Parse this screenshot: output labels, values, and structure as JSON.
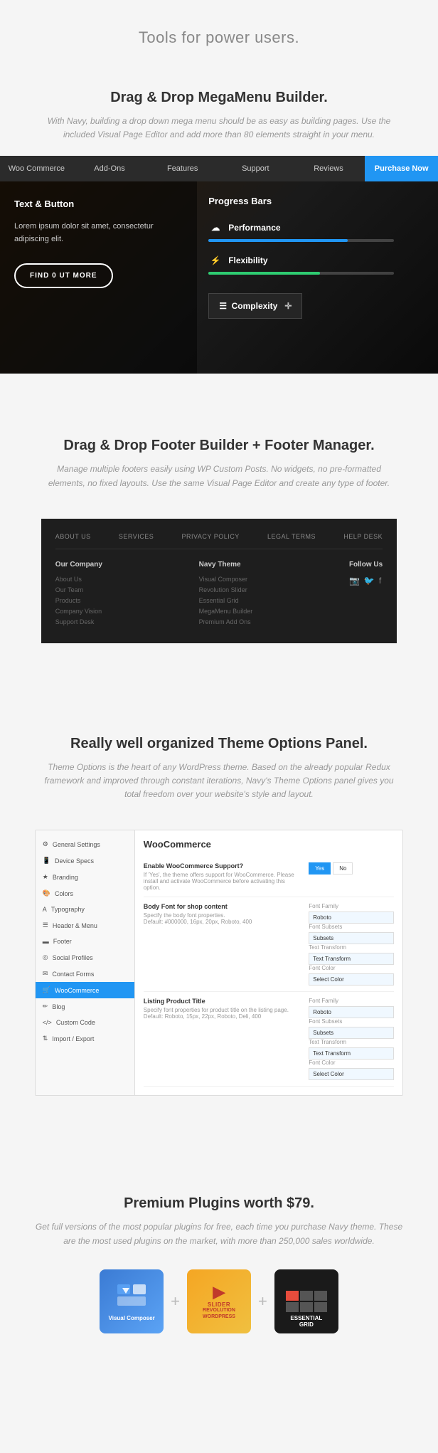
{
  "hero": {
    "title": "Tools for power users."
  },
  "megamenu": {
    "heading": "Drag & Drop MegaMenu Builder.",
    "description": "With Navy, building a drop down mega menu should be as easy as building pages. Use the included Visual Page Editor and add more than 80 elements straight in your menu."
  },
  "navbar": {
    "items": [
      {
        "label": "Woo Commerce",
        "active": false
      },
      {
        "label": "Add-Ons",
        "active": false
      },
      {
        "label": "Features",
        "active": false
      },
      {
        "label": "Support",
        "active": false
      },
      {
        "label": "Reviews",
        "active": false
      },
      {
        "label": "Purchase Now",
        "active": true
      }
    ]
  },
  "demo": {
    "left_heading": "Text & Button",
    "left_body": "Lorem ipsum dolor sit amet, consectetur adipiscing elit.",
    "find_out_more": "FIND 0 UT MoRE",
    "right_heading": "Progress Bars",
    "progress_items": [
      {
        "label": "Performance",
        "fill": 75,
        "icon": "☁"
      },
      {
        "label": "Flexibility",
        "fill": 60,
        "icon": "⚡"
      }
    ],
    "complexity_label": "Complexity"
  },
  "footer_builder": {
    "heading": "Drag & Drop Footer Builder + Footer Manager.",
    "description": "Manage multiple footers easily using WP Custom Posts. No widgets, no pre-formatted elements, no fixed layouts. Use the same Visual Page Editor and create any type of footer.",
    "footer_nav": [
      "ABOUT US",
      "SERVICES",
      "PRIVACY POLICY",
      "LEGAL TERMS",
      "HELP DESK"
    ],
    "footer_cols": [
      {
        "heading": "Our Company",
        "links": [
          "About Us",
          "Our Team",
          "Products",
          "Company Vision",
          "Support Desk"
        ]
      },
      {
        "heading": "Navy Theme",
        "links": [
          "Visual Composer",
          "Revolution Slider",
          "Essential Grid",
          "MegaMenu Builder",
          "Premium Add Ons"
        ]
      },
      {
        "heading": "Follow Us",
        "social": [
          "📷",
          "🐦",
          "f"
        ]
      }
    ]
  },
  "theme_options": {
    "heading": "Really well organized Theme Options Panel.",
    "description": "Theme Options is the heart of any WordPress theme. Based on the already popular Redux framework and improved through constant iterations, Navy's Theme Options panel gives you total freedom over your website's style and layout.",
    "sidebar_items": [
      {
        "label": "General Settings",
        "icon": "⚙",
        "active": false
      },
      {
        "label": "Device Specs",
        "icon": "📱",
        "active": false
      },
      {
        "label": "Branding",
        "icon": "★",
        "active": false
      },
      {
        "label": "Colors",
        "icon": "🎨",
        "active": false
      },
      {
        "label": "Typography",
        "icon": "A",
        "active": false
      },
      {
        "label": "Header & Menu",
        "icon": "☰",
        "active": false
      },
      {
        "label": "Footer",
        "icon": "▬",
        "active": false
      },
      {
        "label": "Social Profiles",
        "icon": "◎",
        "active": false
      },
      {
        "label": "Contact Forms",
        "icon": "✉",
        "active": false
      },
      {
        "label": "WooCommerce",
        "icon": "🛒",
        "active": true
      },
      {
        "label": "Blog",
        "icon": "✏",
        "active": false
      },
      {
        "label": "Custom Code",
        "icon": "</>",
        "active": false
      },
      {
        "label": "Import / Export",
        "icon": "⇅",
        "active": false
      }
    ],
    "panel_title": "WooCommerce",
    "options": [
      {
        "label": "Enable WooCommerce Support?",
        "desc": "If 'Yes', the theme offers support for WooCommerce. Please install and activate WooCommerce before activating this option.",
        "control": "yes_no",
        "yes_active": true
      },
      {
        "label": "Body Font for shop content",
        "desc": "Specify the body font properties.",
        "desc2": "Default: #000000, 16px, 20px, Roboto, 400",
        "control": "font",
        "sub_label1": "Font Family",
        "sub_val1": "Roboto",
        "sub_label2": "Font Subsets",
        "sub_val2": "Subsets",
        "sub_label3": "Text Transform",
        "sub_val3": "Text Transform",
        "sub_label4": "Font Color",
        "sub_val4": "Select Color"
      },
      {
        "label": "Listing Product Title",
        "desc": "Specify font properties for product title on the listing page.",
        "desc2": "Default: Roboto, 15px, 22px, Roboto, Deli, 400",
        "control": "font",
        "sub_label1": "Font Family",
        "sub_val1": "Roboto",
        "sub_label2": "Font Subsets",
        "sub_val2": "Subsets",
        "sub_label3": "Text Transform",
        "sub_val3": "Text Transform",
        "sub_label4": "Font Color",
        "sub_val4": "Select Color"
      }
    ]
  },
  "plugins": {
    "heading": "Premium Plugins worth $79.",
    "description": "Get full versions of the most popular plugins for free, each time you purchase Navy theme. These are the most used plugins on the market, with more than 250,000 sales worldwide.",
    "items": [
      {
        "name": "Visual Composer",
        "type": "vc"
      },
      {
        "name": "Slider Revolution",
        "type": "slider"
      },
      {
        "name": "Essential Grid",
        "type": "essential"
      }
    ],
    "plus": "+"
  }
}
